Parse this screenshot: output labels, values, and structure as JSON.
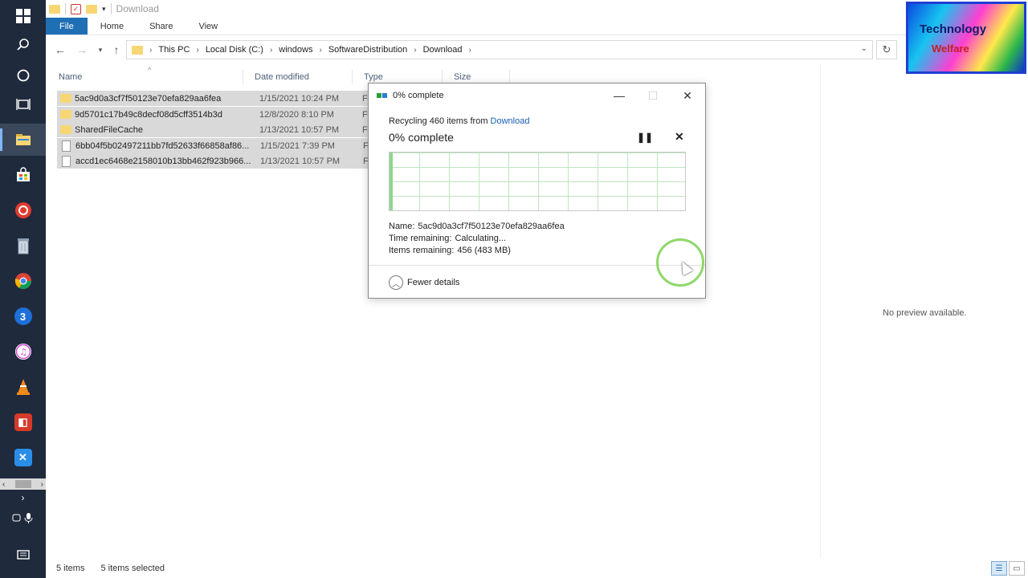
{
  "window": {
    "title": "Download"
  },
  "ribbon": {
    "tabs": [
      "File",
      "Home",
      "Share",
      "View"
    ]
  },
  "address": {
    "crumbs": [
      "This PC",
      "Local Disk (C:)",
      "windows",
      "SoftwareDistribution",
      "Download"
    ]
  },
  "columns": {
    "name": "Name",
    "date": "Date modified",
    "type": "Type",
    "size": "Size"
  },
  "files": [
    {
      "name": "5ac9d0a3cf7f50123e70efa829aa6fea",
      "date": "1/15/2021 10:24 PM",
      "type": "F",
      "icon": "folder-icon"
    },
    {
      "name": "9d5701c17b49c8decf08d5cff3514b3d",
      "date": "12/8/2020 8:10 PM",
      "type": "F",
      "icon": "folder-icon"
    },
    {
      "name": "SharedFileCache",
      "date": "1/13/2021 10:57 PM",
      "type": "F",
      "icon": "folder-icon"
    },
    {
      "name": "6bb04f5b02497211bb7fd52633f66858af86...",
      "date": "1/15/2021 7:39 PM",
      "type": "F",
      "icon": "file-icon"
    },
    {
      "name": "accd1ec6468e2158010b13bb462f923b966...",
      "date": "1/13/2021 10:57 PM",
      "type": "F",
      "icon": "file-icon"
    }
  ],
  "preview": {
    "text": "No preview available."
  },
  "status": {
    "items": "5 items",
    "selected": "5 items selected"
  },
  "logo": {
    "line1": "Technology",
    "line2": "Welfare"
  },
  "dialog": {
    "title": "0% complete",
    "from_prefix": "Recycling 460 items from ",
    "from_link": "Download",
    "percent_text": "0% complete",
    "progress_fraction": 0.01,
    "name_label": "Name:",
    "name_value": "5ac9d0a3cf7f50123e70efa829aa6fea",
    "time_label": "Time remaining:",
    "time_value": "Calculating...",
    "items_label": "Items remaining:",
    "items_value": "456 (483 MB)",
    "fewer_details": "Fewer details"
  },
  "taskbar": {
    "icons": [
      "windows-start-icon",
      "search-icon",
      "cortana-icon",
      "task-view-icon",
      "file-explorer-icon",
      "store-icon",
      "record-icon",
      "trash-icon",
      "chrome-icon",
      "app-3-icon",
      "itunes-icon",
      "vlc-icon",
      "app-red-icon",
      "app-blue-icon"
    ]
  }
}
